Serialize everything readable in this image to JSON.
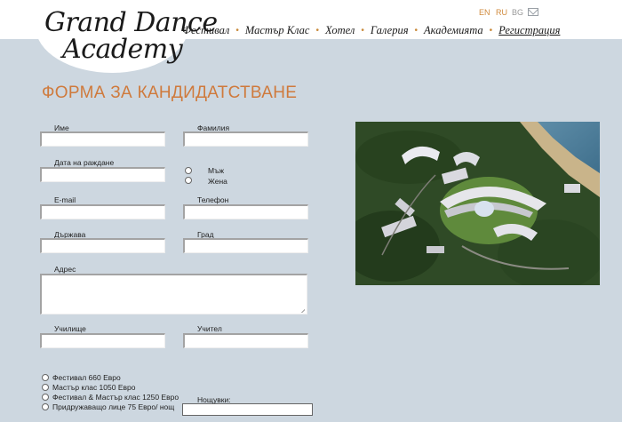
{
  "logo": {
    "line1": "Grand Dance",
    "line2": "Academy"
  },
  "nav": {
    "items": [
      {
        "label": "Фестивал"
      },
      {
        "label": "Мастър Клас"
      },
      {
        "label": "Хотел"
      },
      {
        "label": "Галерия"
      },
      {
        "label": "Академията"
      },
      {
        "label": "Регистрация"
      }
    ]
  },
  "languages": [
    "EN",
    "RU",
    "BG"
  ],
  "form": {
    "title": "ФОРМА ЗА КАНДИДАТСТВАНЕ",
    "first_name_label": "Име",
    "last_name_label": "Фамилия",
    "birth_date_label": "Дата на раждане",
    "gender": {
      "male": "Мъж",
      "female": "Жена"
    },
    "email_label": "E-mail",
    "phone_label": "Телефон",
    "country_label": "Държава",
    "city_label": "Град",
    "address_label": "Адрес",
    "school_label": "Училище",
    "teacher_label": "Учител",
    "packages": [
      {
        "label": "Фестивал 660 Евро"
      },
      {
        "label": "Мастър клас 1050 Евро"
      },
      {
        "label": "Фестивал & Мастър клас 1250 Евро"
      },
      {
        "label": "Придружаващо лице 75 Евро/ нощ"
      }
    ],
    "nights_label": "Нощувки:"
  },
  "colors": {
    "accent": "#cf7a3c",
    "background": "#cdd7e0",
    "header": "#ffffff"
  },
  "icons": [
    "mail-icon",
    "resize-handle-icon"
  ]
}
